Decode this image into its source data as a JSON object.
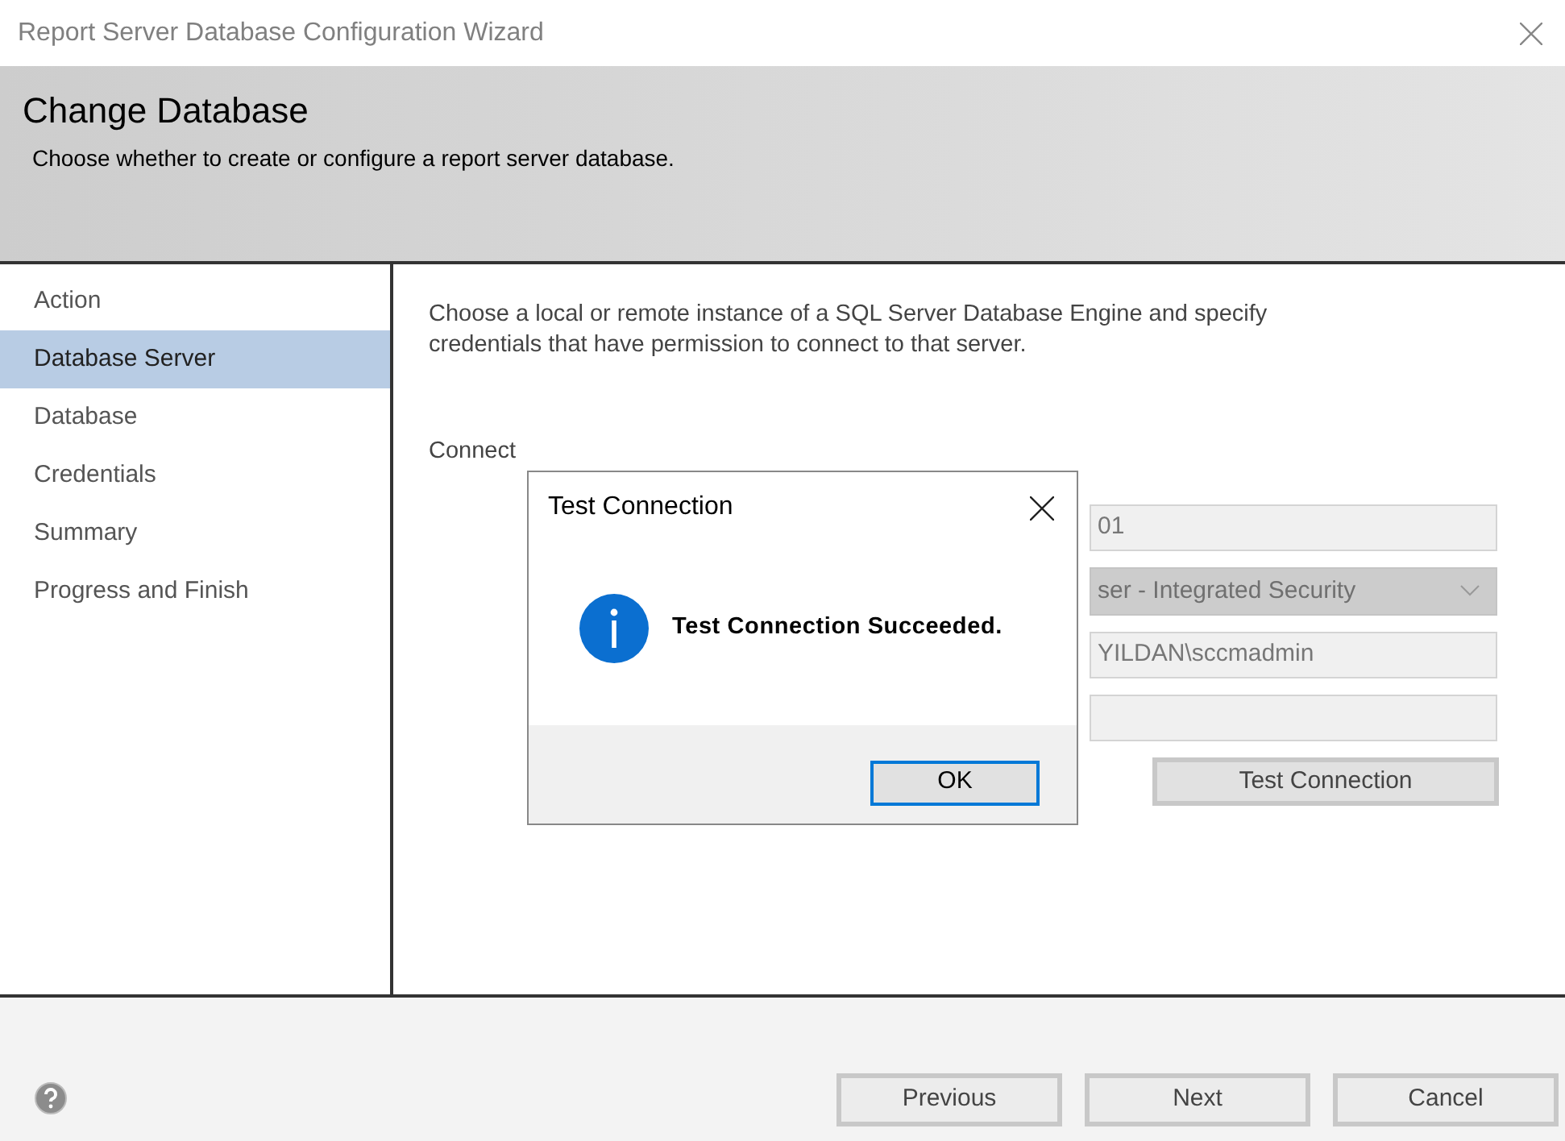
{
  "window": {
    "title": "Report Server Database Configuration Wizard"
  },
  "header": {
    "title": "Change Database",
    "subtitle": "Choose whether to create or configure a report server database."
  },
  "sidebar": {
    "items": [
      {
        "label": "Action",
        "selected": false
      },
      {
        "label": "Database Server",
        "selected": true
      },
      {
        "label": "Database",
        "selected": false
      },
      {
        "label": "Credentials",
        "selected": false
      },
      {
        "label": "Summary",
        "selected": false
      },
      {
        "label": "Progress and Finish",
        "selected": false
      }
    ]
  },
  "content": {
    "description": "Choose a local or remote instance of a SQL Server Database Engine and specify credentials that have permission to connect to that server.",
    "section_label": "Connect",
    "fields": [
      {
        "kind": "text",
        "value": "01"
      },
      {
        "kind": "dropdown",
        "value": "ser - Integrated Security"
      },
      {
        "kind": "text",
        "value": "YILDAN\\sccmadmin"
      },
      {
        "kind": "text"
      }
    ],
    "test_button": "Test Connection"
  },
  "dialog": {
    "title": "Test Connection",
    "message": "Test Connection Succeeded.",
    "ok_button": "OK"
  },
  "footer": {
    "buttons": [
      "Previous",
      "Next",
      "Cancel"
    ]
  }
}
